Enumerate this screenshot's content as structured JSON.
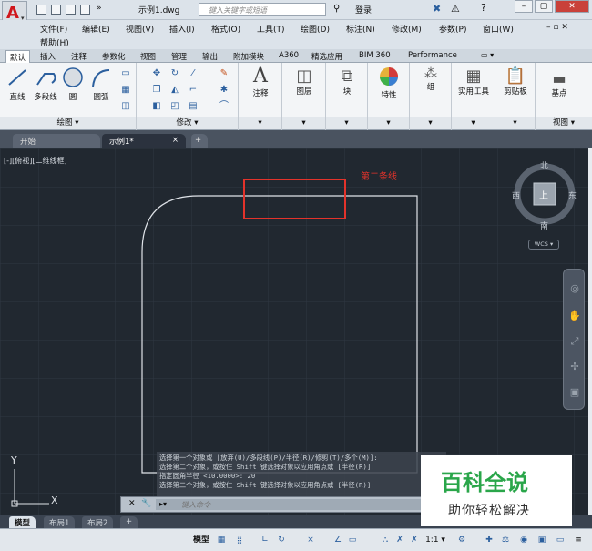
{
  "title_bar": {
    "filename": "示例1.dwg",
    "search_placeholder": "键入关键字或短语",
    "login": "登录",
    "app_menu_arrow": "▾"
  },
  "menu": [
    "文件(F)",
    "编辑(E)",
    "视图(V)",
    "插入(I)",
    "格式(O)",
    "工具(T)",
    "绘图(D)",
    "标注(N)",
    "修改(M)",
    "参数(P)",
    "窗口(W)"
  ],
  "menu_help": "帮助(H)",
  "ribbon_tabs": [
    "默认",
    "插入",
    "注释",
    "参数化",
    "视图",
    "管理",
    "输出",
    "附加模块",
    "A360",
    "精选应用",
    "BIM 360",
    "Performance"
  ],
  "ribbon": {
    "draw_tools": [
      "直线",
      "多段线",
      "圆",
      "圆弧"
    ],
    "draw_title": "绘图",
    "modify_title": "修改",
    "annotate": "注释",
    "layers": "图层",
    "block": "块",
    "properties": "特性",
    "groups": "组",
    "utilities": "实用工具",
    "clipboard": "剪贴板",
    "base": "基点",
    "view_title": "视图"
  },
  "doc_tabs": [
    "开始",
    "示例1*"
  ],
  "doc_tab_close": "×",
  "doc_tab_add": "+",
  "viewport": {
    "label": "[-][俯视][二维线框]",
    "annotation": "第二条线",
    "compass": {
      "north": "北",
      "south": "南",
      "east": "东",
      "west": "西",
      "center": "上"
    },
    "wcs": "WCS ▾",
    "ucs_x": "X",
    "ucs_y": "Y"
  },
  "command": {
    "history": [
      "选择第一个对象或 [放弃(U)/多段线(P)/半径(R)/修剪(T)/多个(M)]:",
      "选择第二个对象，或按住 Shift 键选择对象以应用角点或 [半径(R)]:",
      "指定圆角半径 <10.0000>: 20",
      "选择第二个对象，或按住 Shift 键选择对象以应用角点或 [半径(R)]:"
    ],
    "input_placeholder": "键入命令"
  },
  "layout_tabs": [
    "模型",
    "布局1",
    "布局2"
  ],
  "layout_add": "+",
  "status": {
    "model": "模型",
    "scale": "1:1 ▾"
  },
  "watermark": {
    "main": "百科全说",
    "sub": "助你轻松解决"
  },
  "colors": {
    "annotation": "#e3332b",
    "canvas": "#212830",
    "watermark_green": "#2aa64a"
  }
}
